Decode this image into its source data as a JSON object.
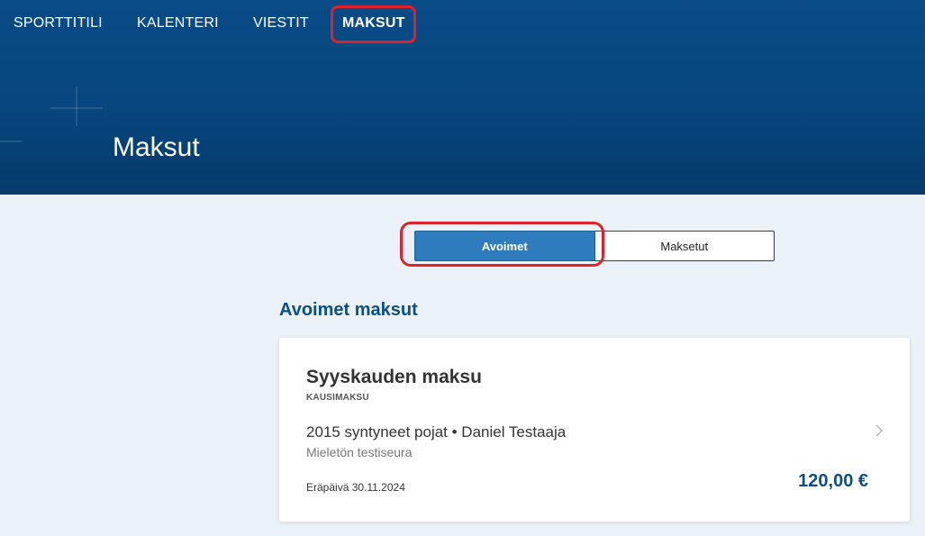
{
  "nav": {
    "items": [
      {
        "label": "SPORTTITILI"
      },
      {
        "label": "KALENTERI"
      },
      {
        "label": "VIESTIT"
      },
      {
        "label": "MAKSUT"
      }
    ]
  },
  "page": {
    "title": "Maksut"
  },
  "tabs": [
    {
      "label": "Avoimet",
      "selected": true
    },
    {
      "label": "Maksetut",
      "selected": false
    }
  ],
  "section": {
    "title": "Avoimet maksut"
  },
  "payments": [
    {
      "title": "Syyskauden maksu",
      "type": "KAUSIMAKSU",
      "group": "2015 syntyneet pojat • Daniel Testaaja",
      "club": "Mieletön testiseura",
      "due": "Eräpäivä 30.11.2024",
      "amount": "120,00 €"
    }
  ],
  "colors": {
    "header_bg": "#07467e",
    "accent": "#2e7bbd",
    "highlight": "#e0202a",
    "heading": "#0b4f86"
  },
  "icons": {
    "card_action": "chevron-right-icon"
  }
}
